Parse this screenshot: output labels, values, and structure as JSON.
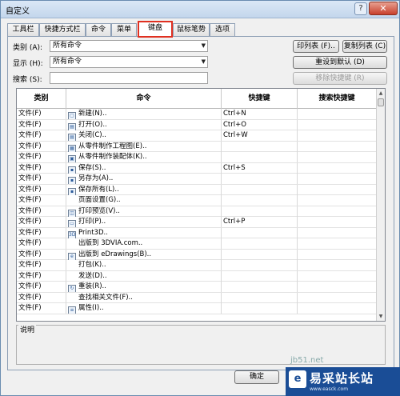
{
  "window": {
    "title": "自定义",
    "help_glyph": "?",
    "close_glyph": "✕"
  },
  "tabs": [
    {
      "label": "工具栏",
      "active": false
    },
    {
      "label": "快捷方式栏",
      "active": false
    },
    {
      "label": "命令",
      "active": false
    },
    {
      "label": "菜单",
      "active": false
    },
    {
      "label": "键盘",
      "active": true
    },
    {
      "label": "鼠标笔势",
      "active": false
    },
    {
      "label": "选项",
      "active": false
    }
  ],
  "filters": {
    "category_label": "类别 (A):",
    "category_value": "所有命令",
    "show_label": "显示 (H):",
    "show_value": "所有命令",
    "search_label": "搜索 (S):",
    "search_value": ""
  },
  "buttons": {
    "print_list": "印列表 (F)..",
    "copy_list": "复制列表 (C)",
    "reset_defaults": "重设到默认 (D)",
    "remove_shortcut": "移除快捷键 (R)",
    "ok": "确定"
  },
  "grid": {
    "columns": [
      "类别",
      "命令",
      "快捷键",
      "搜索快捷键"
    ],
    "rows": [
      {
        "category": "文件(F)",
        "icon": "new-file-icon",
        "glyph": "▢",
        "command": "新建(N)..",
        "shortcut": "Ctrl+N",
        "search": ""
      },
      {
        "category": "文件(F)",
        "icon": "open-folder-icon",
        "glyph": "▤",
        "command": "打开(O)..",
        "shortcut": "Ctrl+O",
        "search": ""
      },
      {
        "category": "文件(F)",
        "icon": "close-file-icon",
        "glyph": "▤",
        "command": "关闭(C)..",
        "shortcut": "Ctrl+W",
        "search": ""
      },
      {
        "category": "文件(F)",
        "icon": "make-drawing-icon",
        "glyph": "▦",
        "command": "从零件制作工程图(E)..",
        "shortcut": "",
        "search": ""
      },
      {
        "category": "文件(F)",
        "icon": "make-assembly-icon",
        "glyph": "▣",
        "command": "从零件制作装配体(K)..",
        "shortcut": "",
        "search": ""
      },
      {
        "category": "文件(F)",
        "icon": "save-icon",
        "glyph": "▪",
        "command": "保存(S)..",
        "shortcut": "Ctrl+S",
        "search": ""
      },
      {
        "category": "文件(F)",
        "icon": "save-as-icon",
        "glyph": "▪",
        "command": "另存为(A)..",
        "shortcut": "",
        "search": ""
      },
      {
        "category": "文件(F)",
        "icon": "save-all-icon",
        "glyph": "▪",
        "command": "保存所有(L)..",
        "shortcut": "",
        "search": ""
      },
      {
        "category": "文件(F)",
        "icon": "",
        "glyph": "",
        "command": "页面设置(G)..",
        "shortcut": "",
        "search": ""
      },
      {
        "category": "文件(F)",
        "icon": "print-preview-icon",
        "glyph": "◫",
        "command": "打印预览(V)..",
        "shortcut": "",
        "search": ""
      },
      {
        "category": "文件(F)",
        "icon": "print-icon",
        "glyph": "▭",
        "command": "打印(P)..",
        "shortcut": "Ctrl+P",
        "search": ""
      },
      {
        "category": "文件(F)",
        "icon": "print3d-icon",
        "glyph": "3D",
        "command": "Print3D..",
        "shortcut": "",
        "search": ""
      },
      {
        "category": "文件(F)",
        "icon": "",
        "glyph": "",
        "command": "出版到 3DVIA.com..",
        "shortcut": "",
        "search": ""
      },
      {
        "category": "文件(F)",
        "icon": "edrawings-icon",
        "glyph": "e",
        "command": "出版到 eDrawings(B)..",
        "shortcut": "",
        "search": ""
      },
      {
        "category": "文件(F)",
        "icon": "",
        "glyph": "",
        "command": "打包(K)..",
        "shortcut": "",
        "search": ""
      },
      {
        "category": "文件(F)",
        "icon": "",
        "glyph": "",
        "command": "发送(D)..",
        "shortcut": "",
        "search": ""
      },
      {
        "category": "文件(F)",
        "icon": "reload-icon",
        "glyph": "↻",
        "command": "重装(R)..",
        "shortcut": "",
        "search": ""
      },
      {
        "category": "文件(F)",
        "icon": "",
        "glyph": "",
        "command": "查找相关文件(F)..",
        "shortcut": "",
        "search": ""
      },
      {
        "category": "文件(F)",
        "icon": "properties-icon",
        "glyph": "≡",
        "command": "属性(I)..",
        "shortcut": "",
        "search": ""
      }
    ]
  },
  "description": {
    "label": "说明"
  },
  "watermark": {
    "logo": "e",
    "brand": "易采站长站",
    "url": "www.easck.com",
    "top_text": "jb51.net"
  }
}
